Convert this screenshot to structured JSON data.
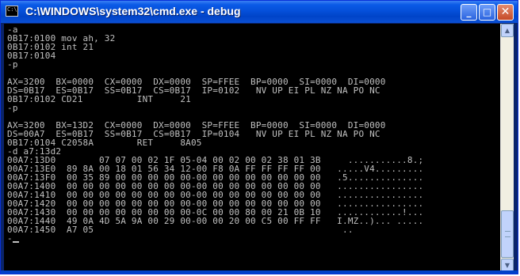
{
  "window": {
    "title": "C:\\WINDOWS\\system32\\cmd.exe - debug",
    "icon_text": "C:\\",
    "minimize_glyph": "_",
    "maximize_glyph": "□",
    "close_glyph": "✕"
  },
  "console": {
    "foreground": "#c0c0c0",
    "background": "#000000",
    "lines": [
      "-a",
      "0B17:0100 mov ah, 32",
      "0B17:0102 int 21",
      "0B17:0104",
      "-p",
      "",
      "AX=3200  BX=0000  CX=0000  DX=0000  SP=FFEE  BP=0000  SI=0000  DI=0000",
      "DS=0B17  ES=0B17  SS=0B17  CS=0B17  IP=0102   NV UP EI PL NZ NA PO NC",
      "0B17:0102 CD21          INT     21",
      "-p",
      "",
      "AX=3200  BX=13D2  CX=0000  DX=0000  SP=FFEE  BP=0000  SI=0000  DI=0000",
      "DS=00A7  ES=0B17  SS=0B17  CS=0B17  IP=0104   NV UP EI PL NZ NA PO NC",
      "0B17:0104 C2058A        RET     8A05",
      "-d a7:13d2",
      "00A7:13D0        07 07 00 02 1F 05-04 00 02 00 02 38 01 3B     ...........8.;",
      "00A7:13E0  89 8A 00 18 01 56 34 12-00 F8 0A FF FF FF FF 00   .....V4.........",
      "00A7:13F0  00 35 89 00 00 00 00 00-00 00 00 00 00 00 00 00   .5..............",
      "00A7:1400  00 00 00 00 00 00 00 00-00 00 00 00 00 00 00 00   ................",
      "00A7:1410  00 00 00 00 00 00 00 00-00 00 00 00 00 00 00 00   ................",
      "00A7:1420  00 00 00 00 00 00 00 00-00 00 00 00 00 00 00 00   ................",
      "00A7:1430  00 00 00 00 00 00 00 00-0C 00 00 80 00 21 0B 10   ............!...",
      "00A7:1440  49 0A 4D 5A 9A 00 29 00-00 00 20 00 C5 00 FF FF   I.MZ..)... .....",
      "00A7:1450  A7 05                                              ..",
      "-"
    ]
  },
  "scrollbar": {
    "up_glyph": "▲",
    "down_glyph": "▼"
  }
}
